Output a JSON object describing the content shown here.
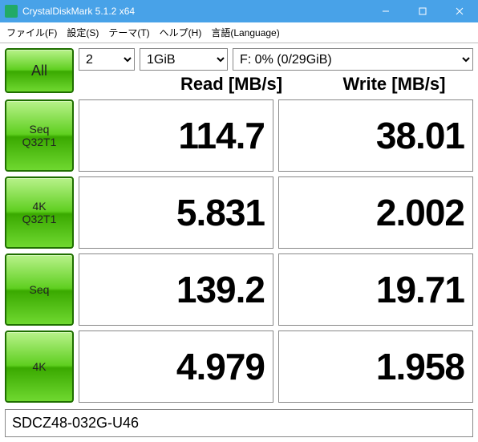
{
  "window": {
    "title": "CrystalDiskMark 5.1.2 x64"
  },
  "menu": {
    "file": "ファイル(F)",
    "setup": "設定(S)",
    "theme": "テーマ(T)",
    "help": "ヘルプ(H)",
    "lang": "言語(Language)"
  },
  "controls": {
    "runs": "2",
    "size": "1GiB",
    "drive": "F: 0% (0/29GiB)"
  },
  "buttons": {
    "all": "All",
    "seq32": "Seq\nQ32T1",
    "rnd32": "4K\nQ32T1",
    "seq": "Seq",
    "rnd": "4K"
  },
  "headers": {
    "read": "Read [MB/s]",
    "write": "Write [MB/s]"
  },
  "results": {
    "seq32": {
      "read": "114.7",
      "write": "38.01"
    },
    "rnd32": {
      "read": "5.831",
      "write": "2.002"
    },
    "seq": {
      "read": "139.2",
      "write": "19.71"
    },
    "rnd": {
      "read": "4.979",
      "write": "1.958"
    }
  },
  "footer": {
    "label": "SDCZ48-032G-U46"
  },
  "chart_data": {
    "type": "table",
    "title": "CrystalDiskMark 5.1.2 x64 benchmark results (MB/s)",
    "columns": [
      "Test",
      "Read",
      "Write"
    ],
    "rows": [
      [
        "Seq Q32T1",
        114.7,
        38.01
      ],
      [
        "4K Q32T1",
        5.831,
        2.002
      ],
      [
        "Seq",
        139.2,
        19.71
      ],
      [
        "4K",
        4.979,
        1.958
      ]
    ]
  }
}
